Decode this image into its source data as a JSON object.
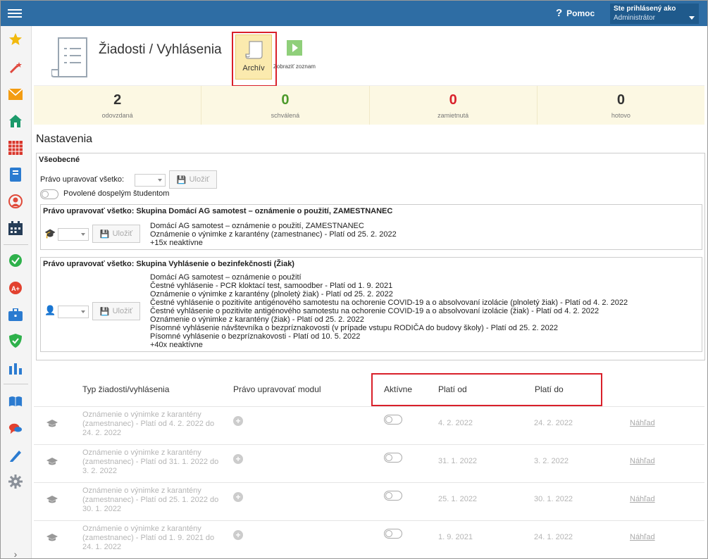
{
  "topbar": {
    "help_label": "Pomoc",
    "user_caption": "Ste prihlásený ako",
    "user_role": "Administrátor"
  },
  "header": {
    "title": "Žiadosti / Vyhlásenia",
    "archive_label": "Archív",
    "show_list_label": "Zobraziť zoznam"
  },
  "stats": [
    {
      "value": "2",
      "label": "odovzdaná"
    },
    {
      "value": "0",
      "label": "schválená"
    },
    {
      "value": "0",
      "label": "zamietnutá"
    },
    {
      "value": "0",
      "label": "hotovo"
    }
  ],
  "settings": {
    "title": "Nastavenia",
    "general_title": "Všeobecné",
    "edit_all_label": "Právo upravovať všetko:",
    "save_label": "Uložiť",
    "adult_students_label": "Povolené dospelým študentom",
    "group1": {
      "title": "Právo upravovať všetko: Skupina Domácí AG samotest – oznámenie o použití, ZAMESTNANEC",
      "lines": [
        "Domácí AG samotest – oznámenie o použití, ZAMESTNANEC",
        "Oznámenie o výnimke z karantény (zamestnanec) - Platí od 25. 2. 2022",
        "+15x neaktívne"
      ]
    },
    "group2": {
      "title": "Právo upravovať všetko: Skupina Vyhlásenie o bezinfekčnosti (Žiak)",
      "lines": [
        "Domácí AG samotest – oznámenie o použití",
        "Čestné vyhlásenie - PCR kloktací test, samoodber - Platí od 1. 9. 2021",
        "Oznámenie o výnimke z karantény (plnoletý žiak) - Platí od 25. 2. 2022",
        "Čestné vyhlásenie o pozitivite antigénového samotestu na ochorenie COVID-19 a o absolvovaní izolácie (plnoletý žiak) - Platí od 4. 2. 2022",
        "Čestné vyhlásenie o pozitivite antigénového samotestu na ochorenie COVID-19 a o absolvovaní izolácie (žiak) - Platí od 4. 2. 2022",
        "Oznámenie o výnimke z karantény (žiak) - Platí od 25. 2. 2022",
        "Písomné vyhlásenie návštevníka o bezpríznakovosti (v prípade vstupu RODIČA do budovy školy) - Platí od 25. 2. 2022",
        "Písomné vyhlásenie o bezpríznakovosti - Platí od 10. 5. 2022",
        "+40x neaktívne"
      ]
    }
  },
  "table": {
    "headers": {
      "type": "Typ žiadosti/vyhlásenia",
      "module_right": "Právo upravovať modul",
      "active": "Aktívne",
      "valid_from": "Platí od",
      "valid_to": "Platí do"
    },
    "preview_label": "Náhľad",
    "rows": [
      {
        "name": "Oznámenie o výnimke z karantény (zamestnanec) - Platí od 4. 2. 2022 do 24. 2. 2022",
        "from": "4. 2. 2022",
        "to": "24. 2. 2022"
      },
      {
        "name": "Oznámenie o výnimke z karantény (zamestnanec) - Platí od 31. 1. 2022 do 3. 2. 2022",
        "from": "31. 1. 2022",
        "to": "3. 2. 2022"
      },
      {
        "name": "Oznámenie o výnimke z karantény (zamestnanec) - Platí od 25. 1. 2022 do 30. 1. 2022",
        "from": "25. 1. 2022",
        "to": "30. 1. 2022"
      },
      {
        "name": "Oznámenie o výnimke z karantény (zamestnanec) - Platí od 1. 9. 2021 do 24. 1. 2022",
        "from": "1. 9. 2021",
        "to": "24. 1. 2022"
      }
    ]
  },
  "colors": {
    "topbar": "#2e6da4",
    "highlight": "#d9202a",
    "stats_bg": "#fcf8e3"
  }
}
